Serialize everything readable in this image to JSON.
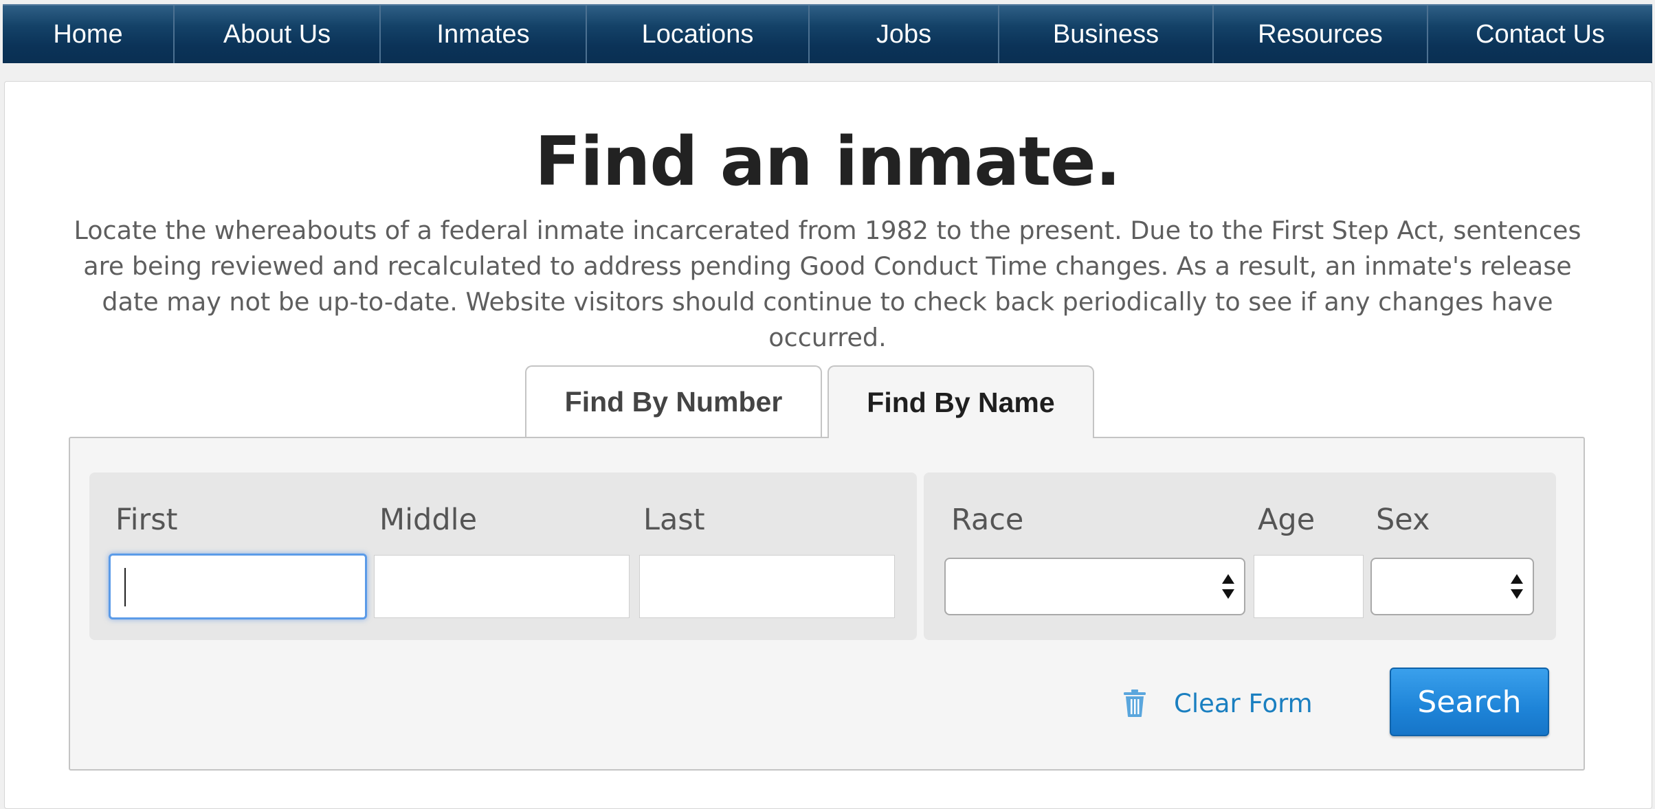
{
  "nav": {
    "items": [
      {
        "label": "Home"
      },
      {
        "label": "About Us"
      },
      {
        "label": "Inmates"
      },
      {
        "label": "Locations"
      },
      {
        "label": "Jobs"
      },
      {
        "label": "Business"
      },
      {
        "label": "Resources"
      },
      {
        "label": "Contact Us"
      }
    ]
  },
  "page": {
    "title": "Find an inmate.",
    "description": "Locate the whereabouts of a federal inmate incarcerated from 1982 to the present. Due to the First Step Act, sentences are being reviewed and recalculated to address pending Good Conduct Time changes. As a result, an inmate's release date may not be up-to-date. Website visitors should continue to check back periodically to see if any changes have occurred."
  },
  "tabs": {
    "by_number": "Find By Number",
    "by_name": "Find By Name",
    "active": "by_name"
  },
  "form": {
    "first_label": "First",
    "middle_label": "Middle",
    "last_label": "Last",
    "race_label": "Race",
    "age_label": "Age",
    "sex_label": "Sex",
    "first_value": "",
    "middle_value": "",
    "last_value": "",
    "age_value": "",
    "race_selected": "",
    "sex_selected": "",
    "clear_label": "Clear Form",
    "search_label": "Search"
  },
  "colors": {
    "nav_bg": "#0b3358",
    "link": "#1a7fc0",
    "button": "#1e84d8",
    "focus": "#5b9be8"
  },
  "icons": {
    "clear": "trash-icon",
    "select": "select-arrows-icon"
  }
}
